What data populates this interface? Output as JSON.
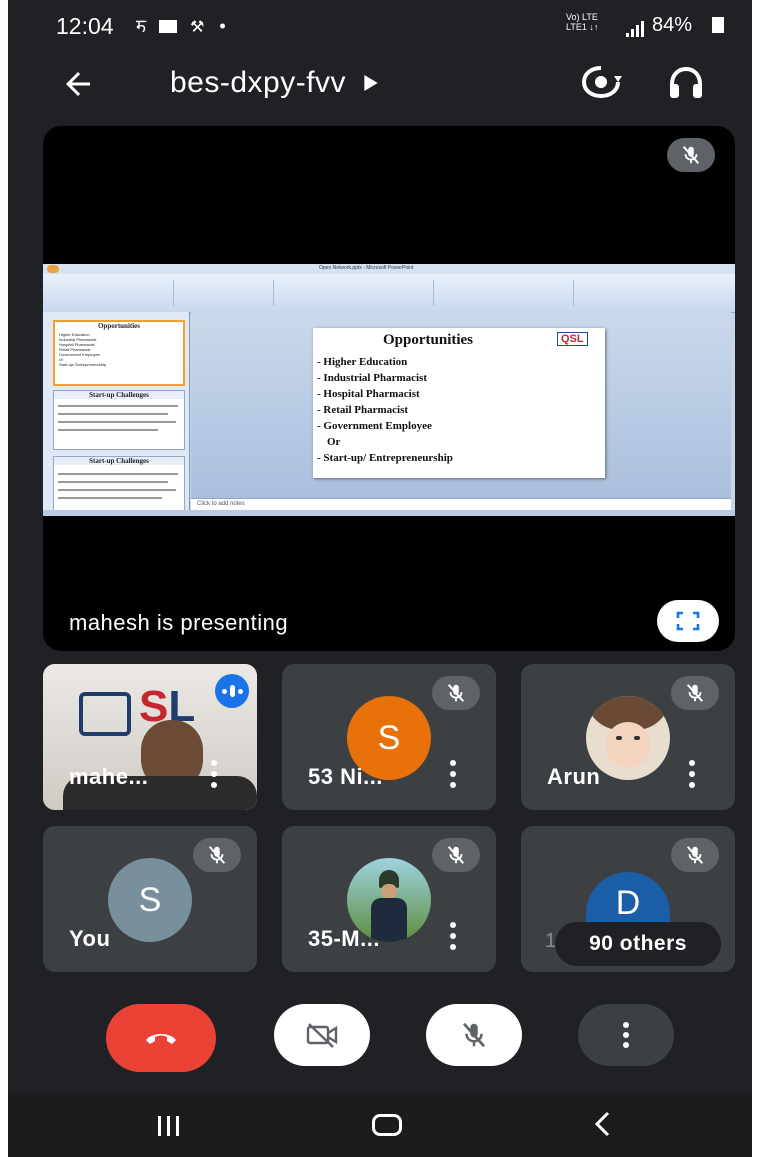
{
  "status_bar": {
    "time": "12:04",
    "network": "Vo) LTE",
    "network_sub": "LTE1 ↓↑",
    "battery": "84%"
  },
  "top_bar": {
    "meeting_code": "bes-dxpy-fvv",
    "icons": [
      "back-arrow-icon",
      "camera-switch-icon",
      "headphones-icon"
    ]
  },
  "stage": {
    "presenting_text": "mahesh is presenting",
    "slide": {
      "window_title": "Open Network.pptx - Microsoft PowerPoint",
      "slide_title": "Opportunities",
      "logo_text": "QSL",
      "bullets": [
        "- Higher Education",
        "- Industrial Pharmacist",
        "- Hospital Pharmacist",
        "- Retail Pharmacist",
        "- Government Employee",
        "Or",
        "- Start-up/ Entrepreneurship"
      ],
      "thumbnails": [
        {
          "title": "Opportunities",
          "lines": [
            "Higher Education",
            "Industrial Pharmacist",
            "Hospital Pharmacist",
            "Retail Pharmacist",
            "Government Employee",
            "Or",
            "Start-up/ Entrepreneurship"
          ]
        },
        {
          "title": "Start-up Challenges",
          "lines": []
        },
        {
          "title": "Start-up Challenges",
          "lines": []
        }
      ],
      "notes_placeholder": "Click to add notes"
    }
  },
  "tiles": [
    {
      "name": "mahe...",
      "type": "video"
    },
    {
      "name": "53 Ni...",
      "avatar_letter": "S",
      "avatar_color": "#e8710a"
    },
    {
      "name": "Arun",
      "type": "photo"
    },
    {
      "name": "You",
      "avatar_letter": "S",
      "avatar_color": "#78909c"
    },
    {
      "name": "35-M...",
      "type": "photo"
    },
    {
      "name": "17",
      "avatar_letter": "D",
      "avatar_color": "#1a5ea8",
      "overflow_label": "90 others"
    }
  ],
  "controls": {
    "end_call_color": "#ea4335",
    "icons": [
      "end-call-icon",
      "camera-off-icon",
      "mic-off-icon",
      "more-options-icon"
    ]
  },
  "nav_bar": {
    "icons": [
      "recent-apps-icon",
      "home-icon",
      "back-icon"
    ]
  }
}
